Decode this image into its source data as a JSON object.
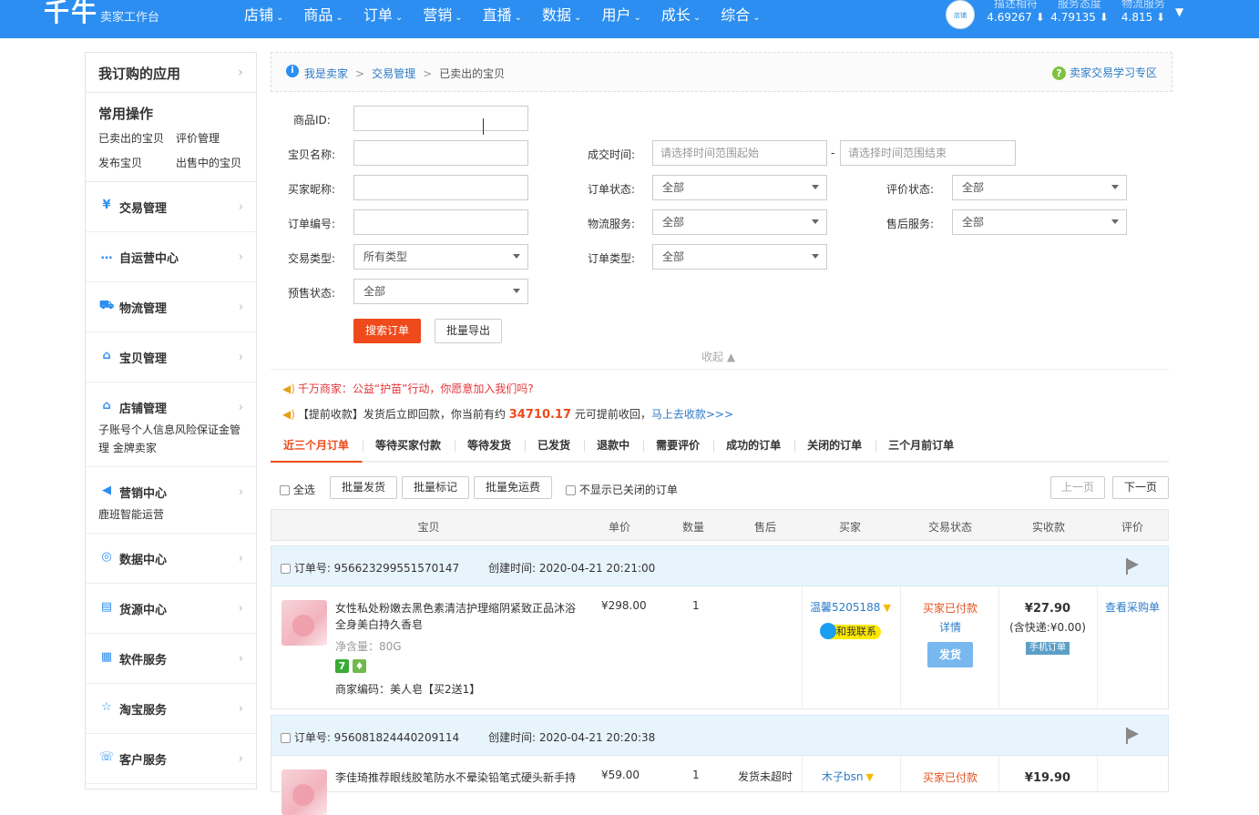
{
  "topbar": {
    "logo": "千牛",
    "logo_sub": "卖家工作台",
    "nav": [
      "店铺",
      "商品",
      "订单",
      "营销",
      "直播",
      "数据",
      "用户",
      "成长",
      "综合"
    ],
    "avatar_text": "店铺",
    "scores": [
      {
        "label": "描述相符",
        "value": "4.69267 ⬇"
      },
      {
        "label": "服务态度",
        "value": "4.79135 ⬇"
      },
      {
        "label": "物流服务",
        "value": "4.815 ⬇"
      }
    ],
    "dropdown_glyph": "▼"
  },
  "sidebar": {
    "subscribed": "我订购的应用",
    "common_title": "常用操作",
    "common_links": [
      "已卖出的宝贝",
      "评价管理",
      "发布宝贝",
      "出售中的宝贝"
    ],
    "items": [
      {
        "label": "交易管理",
        "icon": "yen-icon",
        "glyph": "¥"
      },
      {
        "label": "自运营中心",
        "icon": "chat-icon",
        "glyph": "…"
      },
      {
        "label": "物流管理",
        "icon": "truck-icon",
        "glyph": "⛟"
      },
      {
        "label": "宝贝管理",
        "icon": "bag-icon",
        "glyph": "⌂"
      },
      {
        "label": "店铺管理",
        "icon": "shop-icon",
        "glyph": "⌂",
        "sub": "子账号个人信息风险保证金管理          金牌卖家"
      },
      {
        "label": "营销中心",
        "icon": "megaphone-icon",
        "glyph": "◀",
        "sub": "鹿班智能运营"
      },
      {
        "label": "数据中心",
        "icon": "compass-icon",
        "glyph": "◎"
      },
      {
        "label": "货源中心",
        "icon": "box-icon",
        "glyph": "▤"
      },
      {
        "label": "软件服务",
        "icon": "grid-icon",
        "glyph": "▦"
      },
      {
        "label": "淘宝服务",
        "icon": "star-icon",
        "glyph": "☆"
      },
      {
        "label": "客户服务",
        "icon": "headset-icon",
        "glyph": "☏"
      }
    ],
    "arrow": "›"
  },
  "breadcrumb": {
    "items": [
      "我是卖家",
      "交易管理",
      "已卖出的宝贝"
    ],
    "sep": ">",
    "help": "卖家交易学习专区"
  },
  "filters": {
    "item_id": "商品ID:",
    "item_name": "宝贝名称:",
    "buyer_nick": "买家昵称:",
    "order_no": "订单编号:",
    "trade_type": "交易类型:",
    "trade_type_value": "所有类型",
    "presale": "预售状态:",
    "presale_value": "全部",
    "deal_time": "成交时间:",
    "time_start_ph": "请选择时间范围起始",
    "time_end_ph": "请选择时间范围结束",
    "time_sep": "-",
    "order_status": "订单状态:",
    "order_status_value": "全部",
    "logistics": "物流服务:",
    "logistics_value": "全部",
    "order_type": "订单类型:",
    "order_type_value": "全部",
    "review_status": "评价状态:",
    "review_status_value": "全部",
    "aftersale": "售后服务:",
    "aftersale_value": "全部",
    "search_btn": "搜索订单",
    "export_btn": "批量导出",
    "collapse": "收起 ▲"
  },
  "notices": {
    "n1": "千万商家：公益“护苗”行动，你愿意加入我们吗?",
    "n2_pre": "【提前收款】发货后立即回款，你当前有约",
    "n2_num": "34710.17",
    "n2_mid": "元可提前收回，",
    "n2_link": "马上去收款>>>"
  },
  "tabs": [
    "近三个月订单",
    "等待买家付款",
    "等待发货",
    "已发货",
    "退款中",
    "需要评价",
    "成功的订单",
    "关闭的订单",
    "三个月前订单"
  ],
  "toolbar": {
    "select_all": "全选",
    "batch_ship": "批量发货",
    "batch_mark": "批量标记",
    "batch_free": "批量免运费",
    "hide_closed": "不显示已关闭的订单",
    "prev": "上一页",
    "next": "下一页"
  },
  "table_head": [
    "宝贝",
    "单价",
    "数量",
    "售后",
    "买家",
    "交易状态",
    "实收款",
    "评价"
  ],
  "orders": [
    {
      "no": "订单号: 956623299551570147",
      "time": "创建时间: 2020-04-21 20:21:00",
      "name": "女性私处粉嫩去黑色素清洁护理缩阴紧致正品沐浴全身美白持久香皂",
      "spec": "净含量：80G",
      "code": "商家编码：美人皂【买2送1】",
      "badge1": "7",
      "badge2": "♦",
      "price": "¥298.00",
      "qty": "1",
      "aftersale": "",
      "buyer": "温馨5205188",
      "contact": "和我联系",
      "status": "买家已付款",
      "detail": "详情",
      "ship": "发货",
      "amount": "¥27.90",
      "shipping": "(含快递:¥0.00)",
      "mobile": "手机订单",
      "review": "查看采购单"
    },
    {
      "no": "订单号: 956081824440209114",
      "time": "创建时间: 2020-04-21 20:20:38",
      "name": "李佳琦推荐眼线胶笔防水不晕染铅笔式硬头新手持",
      "price": "¥59.00",
      "qty": "1",
      "aftersale": "发货未超时",
      "buyer": "木子bsn",
      "status": "买家已付款",
      "amount": "¥19.90"
    }
  ]
}
